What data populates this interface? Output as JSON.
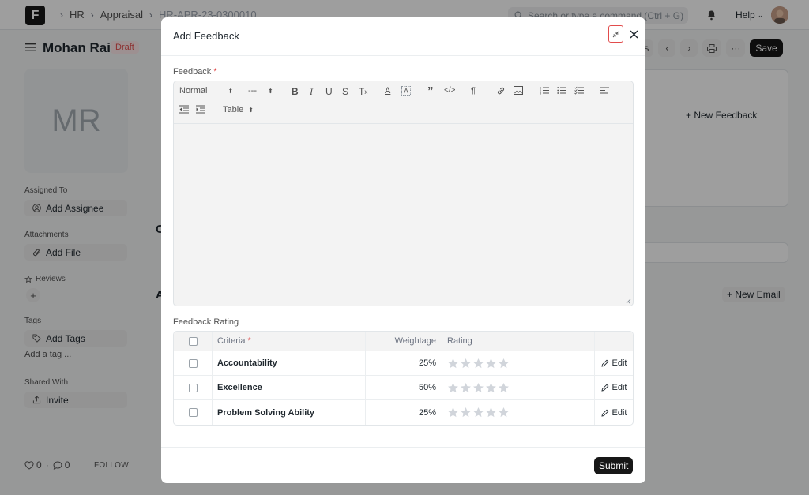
{
  "navbar": {
    "logo": "F",
    "breadcrumbs": [
      "HR",
      "Appraisal",
      "HR-APR-23-0300010"
    ],
    "search_placeholder": "Search or type a command (Ctrl + G)",
    "help": "Help"
  },
  "page": {
    "title": "Mohan Rai",
    "status": "Draft",
    "actions_partial": "als",
    "save": "Save"
  },
  "sidebar": {
    "avatar_initials": "MR",
    "assigned_to_label": "Assigned To",
    "add_assignee": "Add Assignee",
    "attachments_label": "Attachments",
    "add_file": "Add File",
    "reviews_label": "Reviews",
    "tags_label": "Tags",
    "add_tags": "Add Tags",
    "add_tag_hint": "Add a tag ...",
    "shared_with_label": "Shared With",
    "invite": "Invite",
    "likes": "0",
    "comments": "0",
    "follow": "FOLLOW"
  },
  "background": {
    "new_feedback": "New Feedback",
    "new_email": "New Email",
    "section_letter_1": "C",
    "section_letter_2": "A"
  },
  "modal": {
    "title": "Add Feedback",
    "feedback_label": "Feedback",
    "required_mark": "*",
    "toolbar": {
      "text_style": "Normal",
      "font_size": "---",
      "table": "Table"
    },
    "rating_label": "Feedback Rating",
    "grid": {
      "headers": {
        "criteria": "Criteria",
        "weightage": "Weightage",
        "rating": "Rating"
      },
      "rows": [
        {
          "criteria": "Accountability",
          "weightage": "25%",
          "stars": 0,
          "edit": "Edit"
        },
        {
          "criteria": "Excellence",
          "weightage": "50%",
          "stars": 0,
          "edit": "Edit"
        },
        {
          "criteria": "Problem Solving Ability",
          "weightage": "25%",
          "stars": 0,
          "edit": "Edit"
        }
      ]
    },
    "submit": "Submit"
  },
  "colors": {
    "overlay": "#000000",
    "primary_button": "#171717",
    "required": "#e24c4c",
    "draft_badge_bg": "#fde9ea",
    "star_empty": "#d1d5db"
  }
}
